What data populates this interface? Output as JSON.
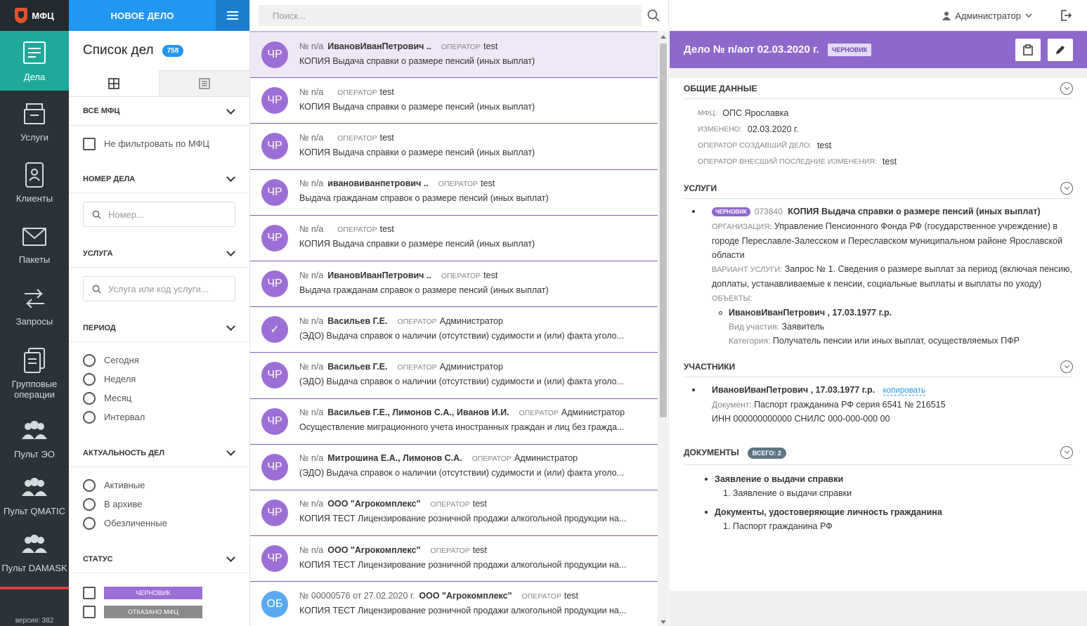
{
  "app": {
    "logo_text": "МФЦ",
    "version": "версия: 382"
  },
  "nav": [
    {
      "label": "Дела",
      "icon": "cases-icon"
    },
    {
      "label": "Услуги",
      "icon": "services-icon"
    },
    {
      "label": "Клиенты",
      "icon": "clients-icon"
    },
    {
      "label": "Пакеты",
      "icon": "packages-icon"
    },
    {
      "label": "Запросы",
      "icon": "requests-icon"
    },
    {
      "label": "Групповые операции",
      "icon": "group-ops-icon"
    },
    {
      "label": "Пульт ЭО",
      "icon": "users-icon"
    },
    {
      "label": "Пульт QMATIC",
      "icon": "users-icon"
    },
    {
      "label": "Пульт DAMASK",
      "icon": "users-icon"
    }
  ],
  "filters": {
    "new_case": "НОВОЕ ДЕЛО",
    "list_title": "Список дел",
    "count": "758",
    "all_mfc": "ВСЕ МФЦ",
    "no_filter_mfc": "Не фильтровать по МФЦ",
    "case_number": "НОМЕР ДЕЛА",
    "number_placeholder": "Номер...",
    "service": "УСЛУГА",
    "service_placeholder": "Услуга или код услуги...",
    "period": "ПЕРИОД",
    "periods": [
      "Сегодня",
      "Неделя",
      "Месяц",
      "Интервал"
    ],
    "relevance": "АКТУАЛЬНОСТЬ ДЕЛ",
    "relevance_opts": [
      "Активные",
      "В архиве",
      "Обезличенные"
    ],
    "status": "СТАТУС",
    "status_opts": [
      {
        "label": "ЧЕРНОВИК",
        "color": "#9c6fd6"
      },
      {
        "label": "ОТКАЗАНО МФЦ",
        "color": "#8a8a8a"
      }
    ]
  },
  "search": {
    "placeholder": "Поиск..."
  },
  "cases": [
    {
      "avatar": "ЧР",
      "num": "№ n/a",
      "name": "ИвановИванПетрович ..",
      "op_label": "ОПЕРАТОР",
      "op": "test",
      "service": "КОПИЯ Выдача справки о размере пенсий (иных выплат)"
    },
    {
      "avatar": "ЧР",
      "num": "№ n/a",
      "name": "",
      "op_label": "ОПЕРАТОР",
      "op": "test",
      "service": "КОПИЯ Выдача справки о размере пенсий (иных выплат)"
    },
    {
      "avatar": "ЧР",
      "num": "№ n/a",
      "name": "",
      "op_label": "ОПЕРАТОР",
      "op": "test",
      "service": "КОПИЯ Выдача справки о размере пенсий (иных выплат)"
    },
    {
      "avatar": "ЧР",
      "num": "№ n/a",
      "name": "ивановиванпетрович ..",
      "op_label": "ОПЕРАТОР",
      "op": "test",
      "service": "Выдача гражданам справок о размере пенсий (иных выплат)"
    },
    {
      "avatar": "ЧР",
      "num": "№ n/a",
      "name": "",
      "op_label": "ОПЕРАТОР",
      "op": "test",
      "service": "КОПИЯ Выдача справки о размере пенсий (иных выплат)"
    },
    {
      "avatar": "ЧР",
      "num": "№ n/a",
      "name": "ИвановИванПетрович ..",
      "op_label": "ОПЕРАТОР",
      "op": "test",
      "service": "Выдача гражданам справок о размере пенсий (иных выплат)"
    },
    {
      "avatar": "✓",
      "num": "№ n/a",
      "name": "Васильев Г.Е.",
      "op_label": "ОПЕРАТОР",
      "op": "Администратор",
      "service": "(ЭДО) Выдача справок о наличии (отсутствии) судимости и (или) факта уголо..."
    },
    {
      "avatar": "ЧР",
      "num": "№ n/a",
      "name": "Васильев Г.Е.",
      "op_label": "ОПЕРАТОР",
      "op": "Администратор",
      "service": "(ЭДО) Выдача справок о наличии (отсутствии) судимости и (или) факта уголо..."
    },
    {
      "avatar": "ЧР",
      "num": "№ n/a",
      "name": "Васильев Г.Е., Лимонов С.А., Иванов И.И.",
      "op_label": "ОПЕРАТОР",
      "op": "Администратор",
      "service": "Осуществление миграционного учета иностранных граждан и лиц без гражда..."
    },
    {
      "avatar": "ЧР",
      "num": "№ n/a",
      "name": "Митрошина Е.А., Лимонов С.А.",
      "op_label": "ОПЕРАТОР",
      "op": "Администратор",
      "service": "(ЭДО) Выдача справок о наличии (отсутствии) судимости и (или) факта уголо..."
    },
    {
      "avatar": "ЧР",
      "num": "№ n/a",
      "name": "ООО \"Агрокомплекс\"",
      "op_label": "ОПЕРАТОР",
      "op": "test",
      "service": "КОПИЯ ТЕСТ Лицензирование розничной продажи алкогольной продукции на..."
    },
    {
      "avatar": "ЧР",
      "num": "№ n/a",
      "name": "ООО \"Агрокомплекс\"",
      "op_label": "ОПЕРАТОР",
      "op": "test",
      "service": "КОПИЯ ТЕСТ Лицензирование розничной продажи алкогольной продукции на..."
    },
    {
      "avatar": "ОБ",
      "num": "№ 00000576 от 27.02.2020 г.",
      "name": "ООО \"Агрокомплекс\"",
      "op_label": "ОПЕРАТОР",
      "op": "test",
      "service": "КОПИЯ ТЕСТ Лицензирование розничной продажи алкогольной продукции на..."
    }
  ],
  "user": {
    "name": "Администратор"
  },
  "detail": {
    "title": "Дело № n/аот 02.03.2020 г.",
    "status": "ЧЕРНОВИК",
    "general": {
      "heading": "ОБЩИЕ ДАННЫЕ",
      "mfc_k": "МФЦ:",
      "mfc_v": "ОПС Ярославка",
      "changed_k": "ИЗМЕНЕНО:",
      "changed_v": "02.03.2020 г.",
      "creator_k": "ОПЕРАТОР СОЗДАВШИЙ ДЕЛО:",
      "creator_v": "test",
      "editor_k": "ОПЕРАТОР ВНЕСШИЙ ПОСЛЕДНИЕ ИЗМЕНЕНИЯ:",
      "editor_v": "test"
    },
    "services": {
      "heading": "УСЛУГИ",
      "tag": "ЧЕРНОВИК",
      "code": "073840",
      "name": "КОПИЯ Выдача справки о размере пенсий (иных выплат)",
      "org_k": "ОРГАНИЗАЦИЯ:",
      "org_v": "Управление Пенсионного Фонда РФ (государственное учреждение) в городе Переславле-Залесском и Переславском муниципальном районе Ярославской области",
      "variant_k": "ВАРИАНТ УСЛУГИ:",
      "variant_v": "Запрос № 1. Сведения о размере выплат за период (включая пенсию, доплаты, устанавливаемые к пенсии, социальные выплаты и выплаты по уходу)",
      "objects_k": "ОБЪЕКТЫ:",
      "object_name": "ИвановИванПетрович , 17.03.1977 г.р.",
      "role_k": "Вид участия:",
      "role_v": "Заявитель",
      "cat_k": "Категория:",
      "cat_v": "Получатель пенсии или иных выплат, осуществляемых ПФР"
    },
    "participants": {
      "heading": "УЧАСТНИКИ",
      "name": "ИвановИванПетрович , 17.03.1977 г.р.",
      "copy": "копировать",
      "doc_k": "Документ:",
      "doc_v": "Паспорт гражданина РФ серия 6541 № 216515",
      "inn_k": "ИНН",
      "inn_v": "000000000000",
      "snils_k": "СНИЛС",
      "snils_v": "000-000-000 00"
    },
    "documents": {
      "heading": "ДОКУМЕНТЫ",
      "total": "ВСЕГО: 2",
      "items": [
        {
          "title": "Заявление о выдачи справки",
          "sub": "1. Заявление о выдачи справки"
        },
        {
          "title": "Документы, удостоверяющие личность гражданина",
          "sub": "1. Паспорт гражданина РФ"
        }
      ]
    }
  }
}
